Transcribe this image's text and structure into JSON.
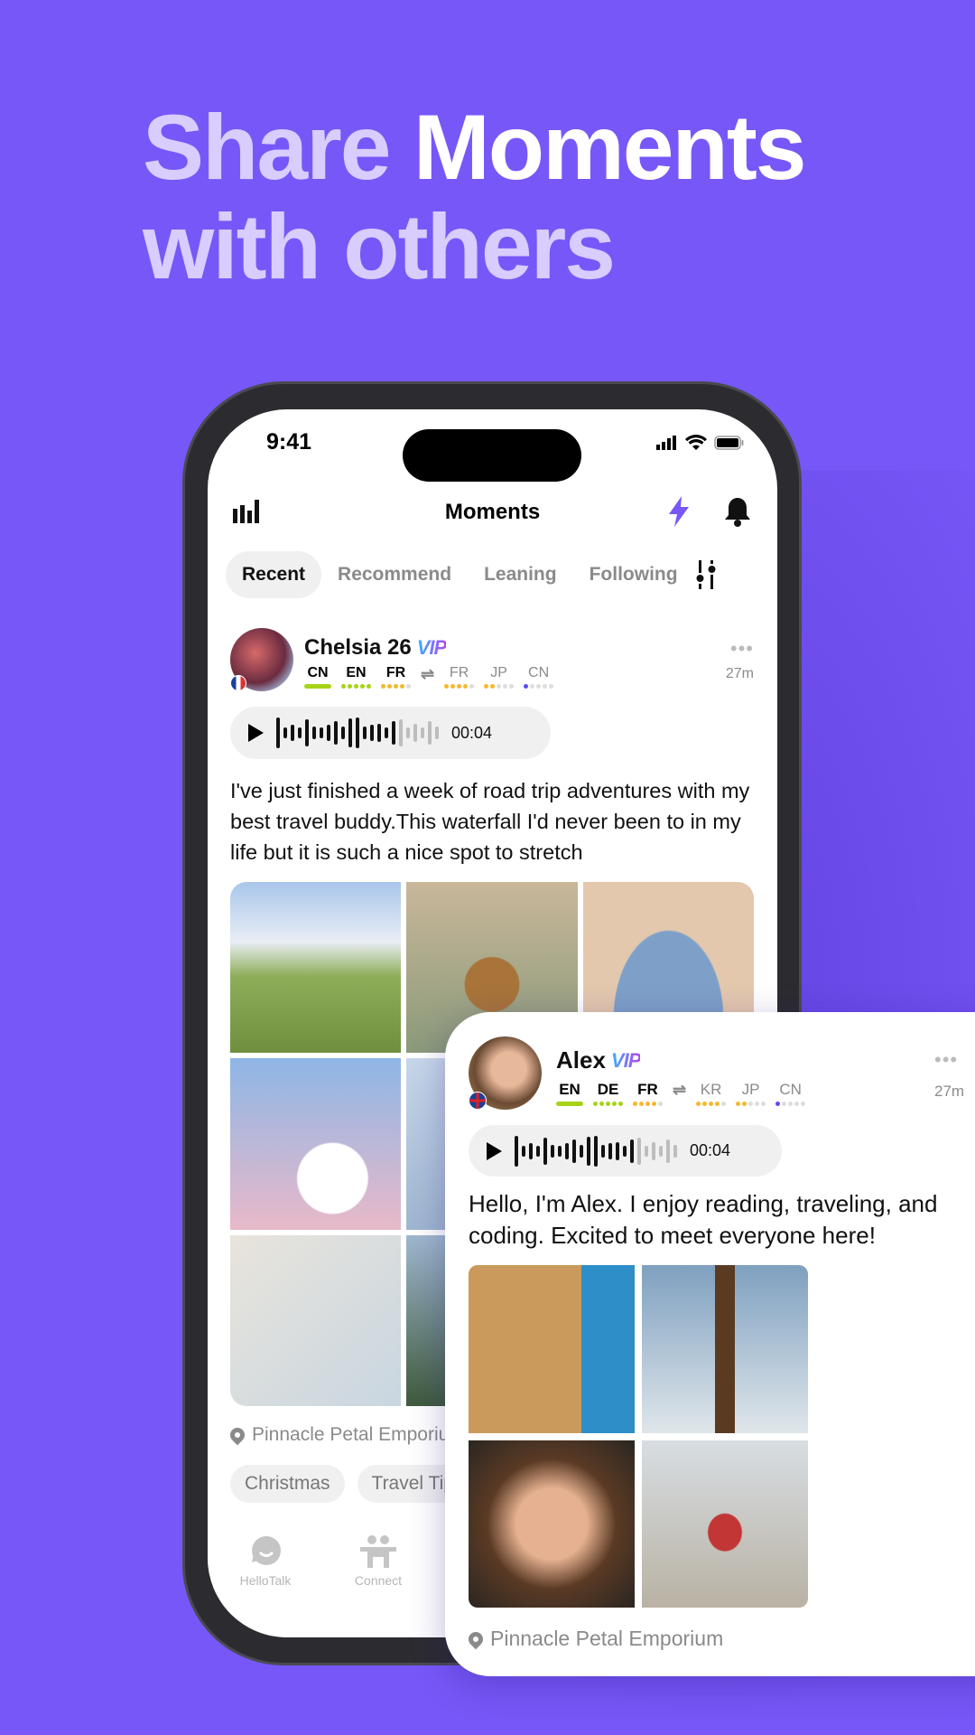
{
  "headline": {
    "part1": "Share",
    "part2": "Moments",
    "part3": "with others"
  },
  "colors": {
    "background": "#7857f8",
    "accent": "#7857f8",
    "native_bar": "#a6d316",
    "level_dot": "#f5b82e",
    "cn_dot": "#5a4cf0"
  },
  "status_bar": {
    "time": "9:41",
    "icons": [
      "signal-icon",
      "wifi-icon",
      "battery-icon"
    ]
  },
  "header": {
    "title": "Moments",
    "left_icon": "stats-icon",
    "right_icons": [
      "lightning-icon",
      "bell-icon"
    ]
  },
  "tabs": [
    {
      "label": "Recent",
      "active": true
    },
    {
      "label": "Recommend"
    },
    {
      "label": "Leaning"
    },
    {
      "label": "Following"
    }
  ],
  "post": {
    "name": "Chelsia 26",
    "badge": "VIP",
    "time_ago": "27m",
    "more": "•••",
    "native": [
      {
        "code": "CN",
        "level": "native"
      },
      {
        "code": "EN",
        "level": 5
      },
      {
        "code": "FR",
        "level": 4
      }
    ],
    "learning": [
      {
        "code": "FR",
        "level": 4
      },
      {
        "code": "JP",
        "level": 2
      },
      {
        "code": "CN",
        "level": 1
      }
    ],
    "audio": {
      "duration": "00:04",
      "played_fraction": 0.7
    },
    "text": "I've just finished a week of road trip adventures with my best travel buddy.This waterfall I'd never been to in my life but it is such a nice spot to stretch",
    "location": "Pinnacle Petal Emporium",
    "tags": [
      "Christmas",
      "Travel Tips"
    ]
  },
  "bottom_nav": [
    {
      "label": "HelloTalk",
      "icon": "chat-smile-icon"
    },
    {
      "label": "Connect",
      "icon": "people-icon"
    }
  ],
  "card": {
    "name": "Alex",
    "badge": "VIP",
    "time_ago": "27m",
    "more": "•••",
    "native": [
      {
        "code": "EN",
        "level": "native"
      },
      {
        "code": "DE",
        "level": 5
      },
      {
        "code": "FR",
        "level": 4
      }
    ],
    "learning": [
      {
        "code": "KR",
        "level": 4
      },
      {
        "code": "JP",
        "level": 2
      },
      {
        "code": "CN",
        "level": 1
      }
    ],
    "audio": {
      "duration": "00:04",
      "played_fraction": 0.7
    },
    "text": "Hello, I'm Alex. I enjoy reading, traveling, and coding. Excited to meet everyone here!",
    "location": "Pinnacle Petal Emporium"
  }
}
